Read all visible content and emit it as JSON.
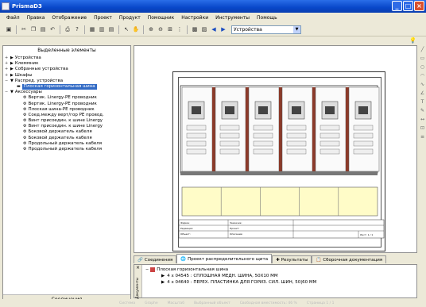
{
  "window": {
    "title": "PrismaD3"
  },
  "menu": [
    "Файл",
    "Правка",
    "Отображение",
    "Проект",
    "Продукт",
    "Помощник",
    "Настройки",
    "Инструменты",
    "Помощь"
  ],
  "toolbar": {
    "combo_value": "Устройства"
  },
  "left_panel": {
    "header": "Выделенные элементы",
    "footer": "Соединения",
    "tree": [
      {
        "label": "Устройства",
        "level": 0,
        "exp": "+",
        "sel": false
      },
      {
        "label": "Клеммник",
        "level": 0,
        "exp": "+",
        "sel": false
      },
      {
        "label": "Собранные устройства",
        "level": 0,
        "exp": "+",
        "sel": false
      },
      {
        "label": "Шкафы",
        "level": 0,
        "exp": "+",
        "sel": false
      },
      {
        "label": "Распред. устройства",
        "level": 0,
        "exp": "−",
        "sel": false
      },
      {
        "label": "Плоская горизонтальная шина",
        "level": 1,
        "exp": "",
        "sel": true
      },
      {
        "label": "Аксессуары",
        "level": 0,
        "exp": "−",
        "sel": false
      },
      {
        "label": "Вертик. Linergy-PE проводник",
        "level": 2,
        "exp": "",
        "sel": false
      },
      {
        "label": "Вертик. Linergy-PE проводник",
        "level": 2,
        "exp": "",
        "sel": false
      },
      {
        "label": "Плоская шина-PE проводник",
        "level": 2,
        "exp": "",
        "sel": false
      },
      {
        "label": "Соед.между верт/гор PE провод.",
        "level": 2,
        "exp": "",
        "sel": false
      },
      {
        "label": "Винт присоедин. к шине Linergy",
        "level": 2,
        "exp": "",
        "sel": false
      },
      {
        "label": "Винт присоедин. к шине Linergy",
        "level": 2,
        "exp": "",
        "sel": false
      },
      {
        "label": "Боковой держатель кабеля",
        "level": 2,
        "exp": "",
        "sel": false
      },
      {
        "label": "Боковой держатель кабеля",
        "level": 2,
        "exp": "",
        "sel": false
      },
      {
        "label": "Продольный держатель кабеля",
        "level": 2,
        "exp": "",
        "sel": false
      },
      {
        "label": "Продольный держатель кабеля",
        "level": 2,
        "exp": "",
        "sel": false
      }
    ]
  },
  "tabs": [
    {
      "label": "Соединения",
      "active": false
    },
    {
      "label": "Проект распределительного щита",
      "active": true
    },
    {
      "label": "Результаты",
      "active": false
    },
    {
      "label": "Сборочная документация",
      "active": false
    }
  ],
  "output": {
    "title": "Плоская горизонтальная шина",
    "items": [
      "4 x 04545 : СПЛОШНАЯ МЕДН. ШИНА, 50X10 MM",
      "4 x 04640 : ПЕРЕХ. ПЛАСТИНКА ДЛЯ ГОРИЗ. СИЛ. ШИН, 50|60 MM"
    ],
    "side_label": "Документы"
  },
  "titleblock": {
    "left": [
      "Фирма:",
      "Редакция:",
      "Объект:"
    ],
    "mid": [
      "Заказчик:",
      "Проект:",
      "Описание:"
    ],
    "sheet": "Лист: 1 / 1"
  },
  "status": [
    "Система",
    "Graphe",
    "Масштаб",
    "Выбранный объект",
    "Свободная вместимость: 46 %",
    "Страница 1 / 1"
  ],
  "colors": {
    "selection": "#316ac5",
    "panel": "#ece9d8",
    "cabinet": "#8b3a2a",
    "busbar": "#fffcc8"
  }
}
